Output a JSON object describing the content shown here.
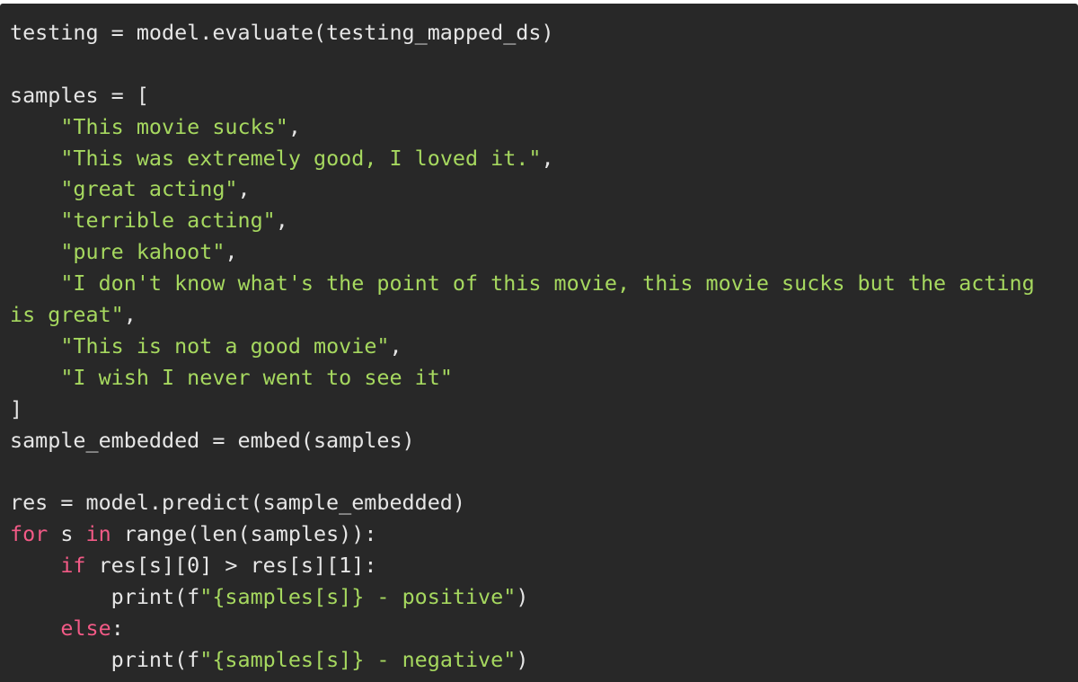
{
  "colors": {
    "background": "#282828",
    "default_text": "#e6e6e6",
    "string": "#a6d85f",
    "keyword": "#f25a86"
  },
  "code": {
    "language": "python",
    "lines": [
      [
        {
          "t": "default",
          "v": "testing = model.evaluate(testing_mapped_ds)"
        }
      ],
      [],
      [
        {
          "t": "default",
          "v": "samples = ["
        }
      ],
      [
        {
          "t": "default",
          "v": "    "
        },
        {
          "t": "string",
          "v": "\"This movie sucks\""
        },
        {
          "t": "default",
          "v": ","
        }
      ],
      [
        {
          "t": "default",
          "v": "    "
        },
        {
          "t": "string",
          "v": "\"This was extremely good, I loved it.\""
        },
        {
          "t": "default",
          "v": ","
        }
      ],
      [
        {
          "t": "default",
          "v": "    "
        },
        {
          "t": "string",
          "v": "\"great acting\""
        },
        {
          "t": "default",
          "v": ","
        }
      ],
      [
        {
          "t": "default",
          "v": "    "
        },
        {
          "t": "string",
          "v": "\"terrible acting\""
        },
        {
          "t": "default",
          "v": ","
        }
      ],
      [
        {
          "t": "default",
          "v": "    "
        },
        {
          "t": "string",
          "v": "\"pure kahoot\""
        },
        {
          "t": "default",
          "v": ","
        }
      ],
      [
        {
          "t": "default",
          "v": "    "
        },
        {
          "t": "string",
          "v": "\"I don't know what's the point of this movie, this movie sucks but the acting"
        }
      ],
      [
        {
          "t": "string",
          "v": "is great\""
        },
        {
          "t": "default",
          "v": ","
        }
      ],
      [
        {
          "t": "default",
          "v": "    "
        },
        {
          "t": "string",
          "v": "\"This is not a good movie\""
        },
        {
          "t": "default",
          "v": ","
        }
      ],
      [
        {
          "t": "default",
          "v": "    "
        },
        {
          "t": "string",
          "v": "\"I wish I never went to see it\""
        }
      ],
      [
        {
          "t": "default",
          "v": "]"
        }
      ],
      [
        {
          "t": "default",
          "v": "sample_embedded = embed(samples)"
        }
      ],
      [],
      [
        {
          "t": "default",
          "v": "res = model.predict(sample_embedded)"
        }
      ],
      [
        {
          "t": "keyword",
          "v": "for"
        },
        {
          "t": "default",
          "v": " s "
        },
        {
          "t": "keyword",
          "v": "in"
        },
        {
          "t": "default",
          "v": " range(len(samples)):"
        }
      ],
      [
        {
          "t": "default",
          "v": "    "
        },
        {
          "t": "keyword",
          "v": "if"
        },
        {
          "t": "default",
          "v": " res[s][0] > res[s][1]:"
        }
      ],
      [
        {
          "t": "default",
          "v": "        print(f"
        },
        {
          "t": "string",
          "v": "\"{samples[s]} - positive\""
        },
        {
          "t": "default",
          "v": ")"
        }
      ],
      [
        {
          "t": "default",
          "v": "    "
        },
        {
          "t": "keyword",
          "v": "else"
        },
        {
          "t": "default",
          "v": ":"
        }
      ],
      [
        {
          "t": "default",
          "v": "        print(f"
        },
        {
          "t": "string",
          "v": "\"{samples[s]} - negative\""
        },
        {
          "t": "default",
          "v": ")"
        }
      ]
    ]
  }
}
